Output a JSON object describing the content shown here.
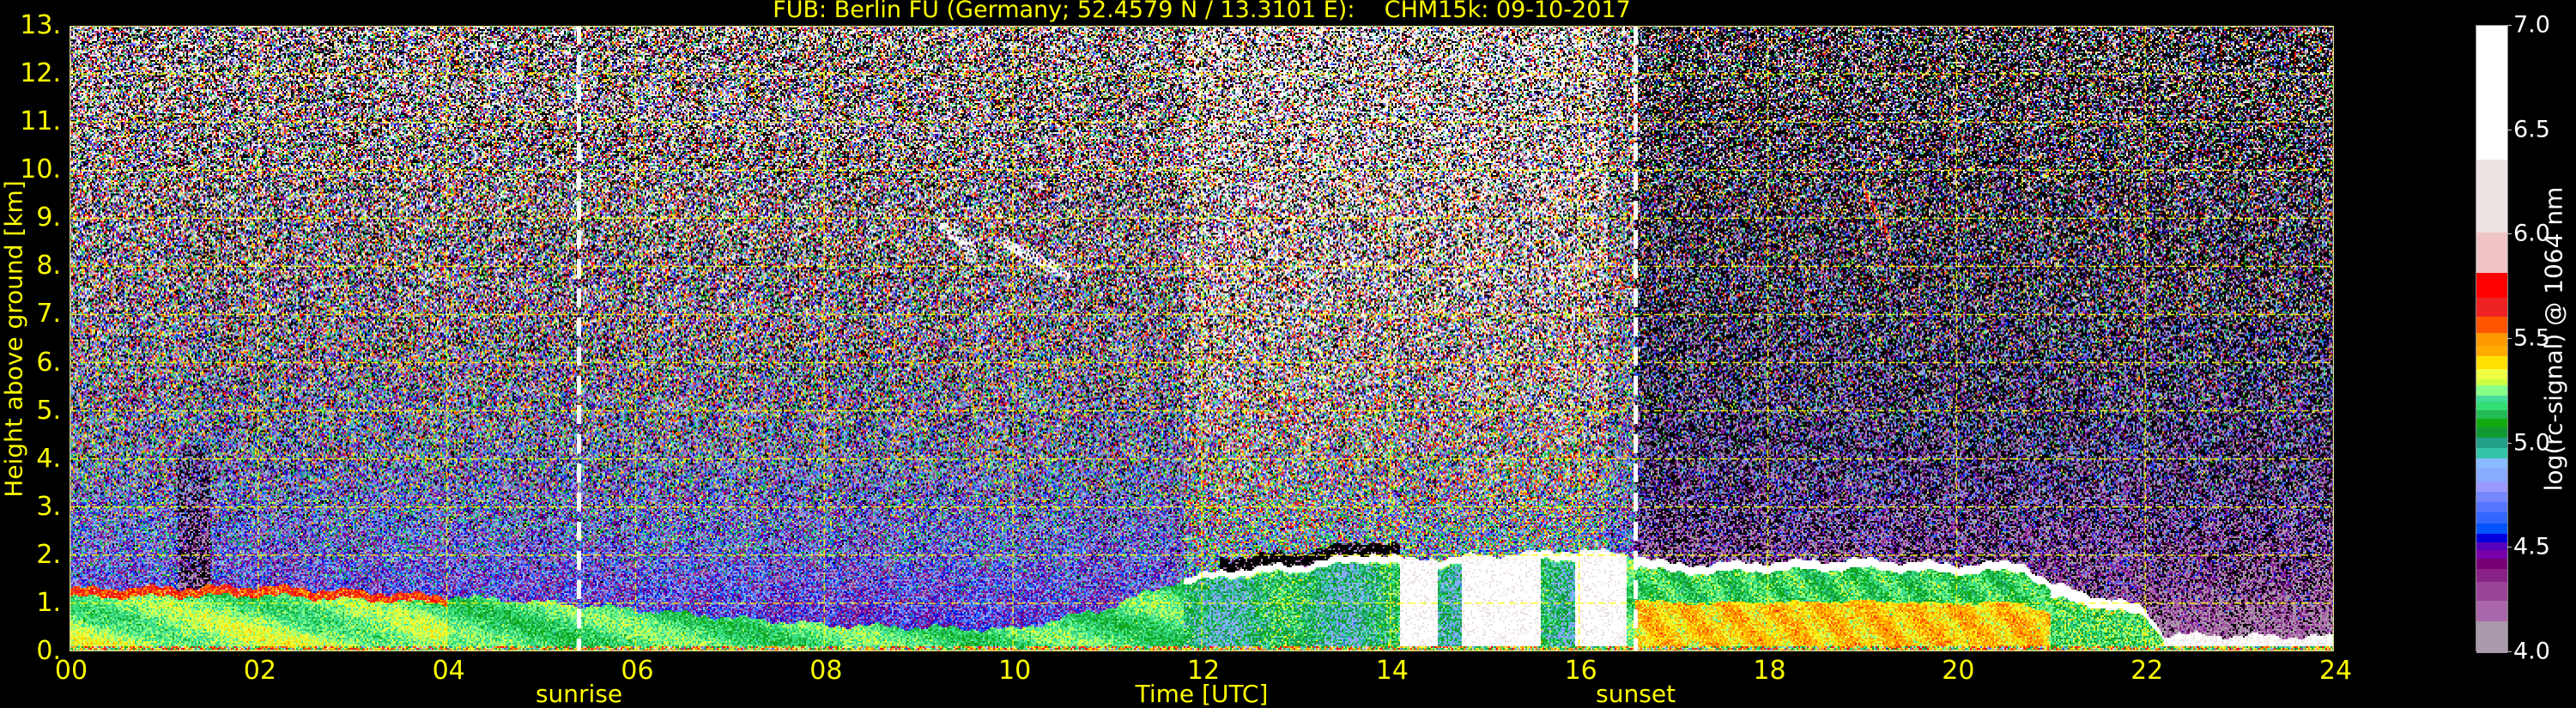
{
  "chart_data": {
    "type": "heatmap",
    "title": "FUB: Berlin FU (Germany; 52.4579 N / 13.3101 E):    CHM15k: 09-10-2017",
    "xlabel": "Time [UTC]",
    "ylabel": "Height above ground [km]",
    "xlim": [
      0,
      24
    ],
    "ylim": [
      0,
      13
    ],
    "x_ticks": [
      0,
      2,
      4,
      6,
      8,
      10,
      12,
      14,
      16,
      18,
      20,
      22,
      24
    ],
    "x_tick_labels": [
      "00",
      "02",
      "04",
      "06",
      "08",
      "10",
      "12",
      "14",
      "16",
      "18",
      "20",
      "22",
      "24"
    ],
    "y_ticks": [
      0,
      1,
      2,
      3,
      4,
      5,
      6,
      7,
      8,
      9,
      10,
      11,
      12,
      13
    ],
    "y_tick_labels": [
      "0.",
      "1.",
      "2.",
      "3.",
      "4.",
      "5.",
      "6.",
      "7.",
      "8.",
      "9.",
      "10.",
      "11.",
      "12.",
      "13."
    ],
    "grid": true,
    "grid_color": "#ffff00",
    "text_color": "#ffff00",
    "annotations": [
      {
        "label": "sunrise",
        "x": 5.4
      },
      {
        "label": "sunset",
        "x": 16.6
      }
    ],
    "boundary_layer_top_km": [
      [
        0,
        1.3
      ],
      [
        2,
        1.35
      ],
      [
        4,
        1.15
      ],
      [
        5.5,
        0.95
      ],
      [
        7,
        0.7
      ],
      [
        8,
        0.55
      ],
      [
        10,
        0.45
      ],
      [
        11,
        0.9
      ],
      [
        11.8,
        1.5
      ],
      [
        12.3,
        1.7
      ],
      [
        13,
        1.8
      ],
      [
        13.8,
        2.05
      ],
      [
        14.2,
        1.9
      ],
      [
        16,
        2.1
      ],
      [
        16.6,
        2.0
      ],
      [
        17,
        1.8
      ],
      [
        18,
        1.85
      ],
      [
        19,
        1.9
      ],
      [
        20,
        1.8
      ],
      [
        20.7,
        1.85
      ],
      [
        21,
        1.4
      ],
      [
        22,
        0.9
      ],
      [
        22.2,
        0.35
      ],
      [
        24,
        0.3
      ]
    ],
    "low_cloud_intervals_h": [
      [
        14.1,
        14.5
      ],
      [
        14.75,
        15.6
      ],
      [
        15.95,
        16.5
      ]
    ],
    "cirrus": [
      {
        "t": [
          9.2,
          9.6
        ],
        "h": [
          8.3,
          8.9
        ]
      },
      {
        "t": [
          9.9,
          10.6
        ],
        "h": [
          7.8,
          8.5
        ]
      },
      {
        "t": [
          19.0,
          19.3
        ],
        "h": [
          8.5,
          9.7
        ]
      }
    ],
    "colorbar": {
      "label": "log(rc-signal) @ 1064 nm",
      "range": [
        4.0,
        7.0
      ],
      "ticks": [
        "4.0",
        "4.5",
        "5.0",
        "5.5",
        "6.0",
        "6.5",
        "7.0"
      ],
      "bounds": [
        4.0,
        4.15,
        4.25,
        4.34,
        4.4,
        4.45,
        4.49,
        4.53,
        4.57,
        4.62,
        4.67,
        4.72,
        4.77,
        4.82,
        4.88,
        4.93,
        4.98,
        5.03,
        5.08,
        5.12,
        5.16,
        5.2,
        5.23,
        5.28,
        5.31,
        5.36,
        5.42,
        5.47,
        5.53,
        5.61,
        5.7,
        5.82,
        6.01,
        6.36,
        7.0
      ],
      "colors": [
        "#aa99aa",
        "#aa66aa",
        "#994499",
        "#882288",
        "#770077",
        "#7700aa",
        "#5500bb",
        "#0000dd",
        "#0055ff",
        "#3366ff",
        "#5577ff",
        "#7788ff",
        "#9999ff",
        "#88aaff",
        "#88bbff",
        "#33c4aa",
        "#22a088",
        "#119933",
        "#11aa11",
        "#22bb55",
        "#33dd77",
        "#44dd99",
        "#88ff88",
        "#ccff44",
        "#eeff44",
        "#ffe000",
        "#ffaa00",
        "#ff9900",
        "#ff5500",
        "#ee2222",
        "#ff0000",
        "#f0c4c4",
        "#ede3e3",
        "#ffffff"
      ],
      "below_range_color": "#000000"
    }
  }
}
